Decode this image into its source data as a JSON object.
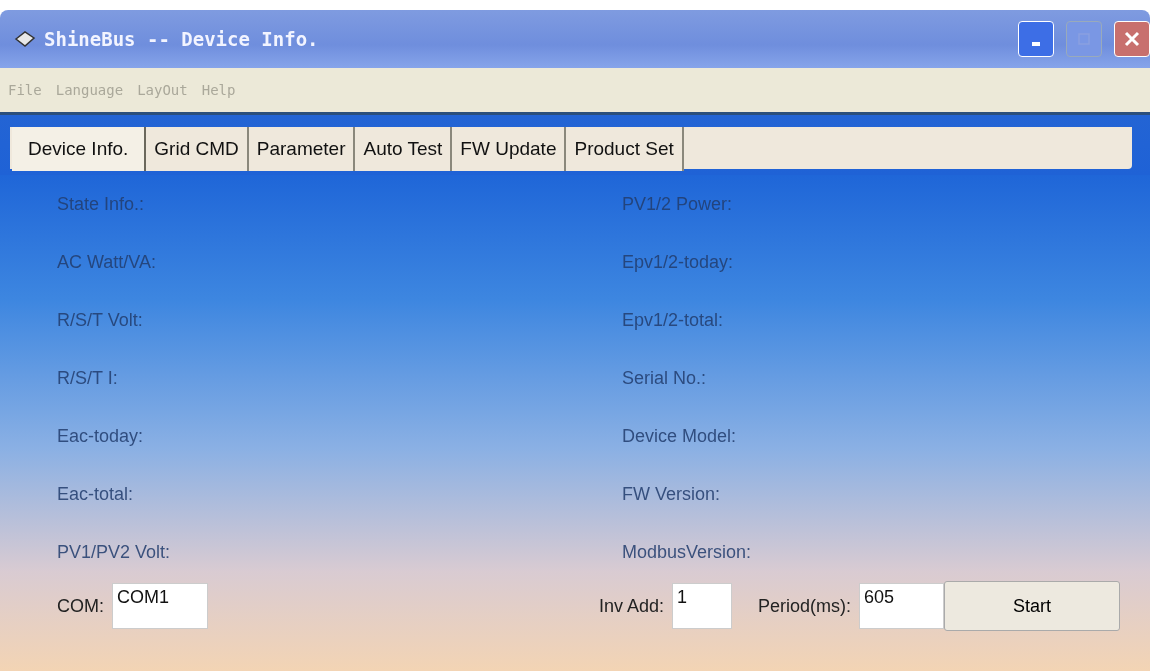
{
  "window": {
    "title": "ShineBus -- Device Info."
  },
  "menu": [
    {
      "label": "File",
      "disabled": true
    },
    {
      "label": "Language",
      "disabled": true
    },
    {
      "label": "LayOut",
      "disabled": true
    },
    {
      "label": "Help",
      "disabled": true
    }
  ],
  "tabs": [
    {
      "label": "Device Info.",
      "selected": true
    },
    {
      "label": "Grid CMD",
      "selected": false
    },
    {
      "label": "Parameter",
      "selected": false
    },
    {
      "label": "Auto Test",
      "selected": false
    },
    {
      "label": "FW Update",
      "selected": false
    },
    {
      "label": "Product Set",
      "selected": false
    }
  ],
  "left_fields": [
    "State Info.:",
    "AC Watt/VA:",
    "R/S/T Volt:",
    "R/S/T I:",
    "Eac-today:",
    "Eac-total:",
    "PV1/PV2 Volt:"
  ],
  "right_fields": [
    "PV1/2 Power:",
    "Epv1/2-today:",
    "Epv1/2-total:",
    "Serial No.:",
    "Device Model:",
    "FW Version:",
    "ModbusVersion:"
  ],
  "controls": {
    "com_label": "COM:",
    "com_value": "COM1",
    "inv_label": "Inv Add:",
    "inv_value": "1",
    "period_label": "Period(ms):",
    "period_value": "605",
    "start_button": "Start"
  }
}
